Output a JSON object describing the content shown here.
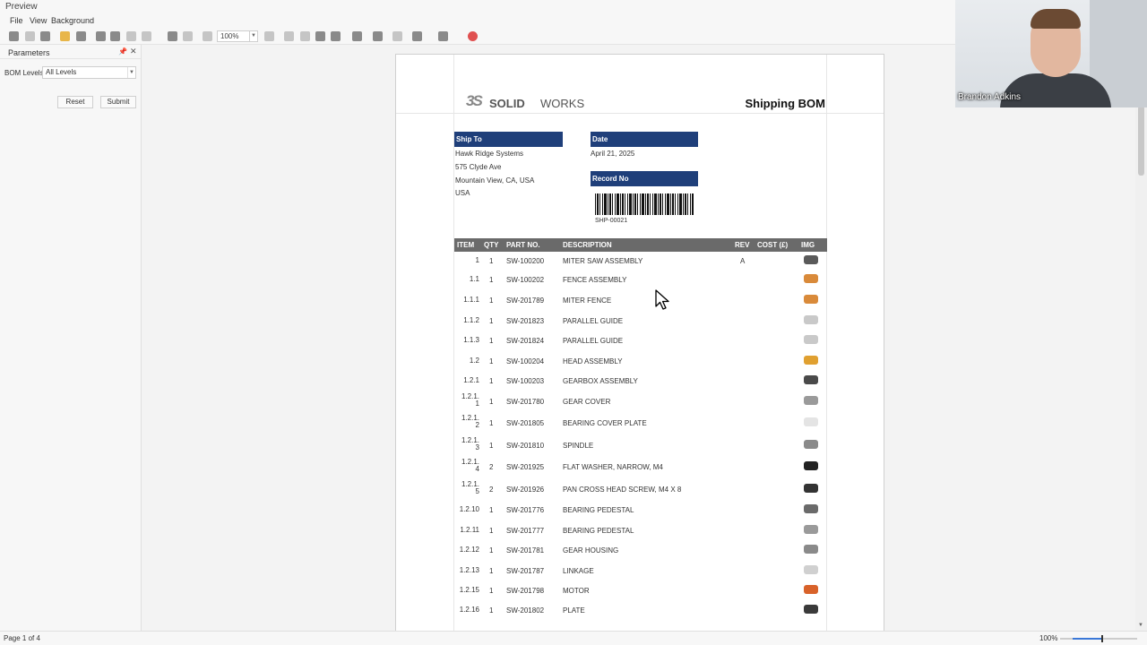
{
  "window": {
    "title": "Preview"
  },
  "menu": {
    "items": [
      "File",
      "View",
      "Background"
    ]
  },
  "toolbar": {
    "zoom_value": "100%"
  },
  "parameters": {
    "title": "Parameters",
    "bom_levels_label": "BOM Levels",
    "bom_levels_value": "All Levels",
    "reset_label": "Reset",
    "submit_label": "Submit"
  },
  "report": {
    "logo_prefix": "SOLID",
    "logo_suffix": "WORKS",
    "logo_mark": "3S",
    "title": "Shipping BOM",
    "ship_to_label": "Ship To",
    "ship_to_lines": [
      "Hawk Ridge Systems",
      "575 Clyde Ave",
      "Mountain View, CA, USA",
      "USA"
    ],
    "date_label": "Date",
    "date_value": "April 21, 2025",
    "record_label": "Record No",
    "record_value": "SHP-00021",
    "columns": [
      "ITEM",
      "QTY",
      "PART NO.",
      "DESCRIPTION",
      "REV",
      "COST (£)",
      "IMG"
    ],
    "rows": [
      {
        "item": "1",
        "qty": "1",
        "part": "SW-100200",
        "desc": "MITER SAW ASSEMBLY",
        "rev": "A",
        "img_color": "#5a5a5a"
      },
      {
        "item": "1.1",
        "qty": "1",
        "part": "SW-100202",
        "desc": "FENCE ASSEMBLY",
        "rev": "",
        "img_color": "#d98a3a"
      },
      {
        "item": "1.1.1",
        "qty": "1",
        "part": "SW-201789",
        "desc": "MITER FENCE",
        "rev": "",
        "img_color": "#d98a3a"
      },
      {
        "item": "1.1.2",
        "qty": "1",
        "part": "SW-201823",
        "desc": "PARALLEL GUIDE",
        "rev": "",
        "img_color": "#c9c9c9"
      },
      {
        "item": "1.1.3",
        "qty": "1",
        "part": "SW-201824",
        "desc": "PARALLEL GUIDE",
        "rev": "",
        "img_color": "#c9c9c9"
      },
      {
        "item": "1.2",
        "qty": "1",
        "part": "SW-100204",
        "desc": "HEAD ASSEMBLY",
        "rev": "",
        "img_color": "#e0a030"
      },
      {
        "item": "1.2.1",
        "qty": "1",
        "part": "SW-100203",
        "desc": "GEARBOX ASSEMBLY",
        "rev": "",
        "img_color": "#4a4a4a"
      },
      {
        "item": "1.2.1.\n1",
        "qty": "1",
        "part": "SW-201780",
        "desc": "GEAR COVER",
        "rev": "",
        "img_color": "#9a9a9a"
      },
      {
        "item": "1.2.1.\n2",
        "qty": "1",
        "part": "SW-201805",
        "desc": "BEARING COVER PLATE",
        "rev": "",
        "img_color": "#e4e4e4"
      },
      {
        "item": "1.2.1.\n3",
        "qty": "1",
        "part": "SW-201810",
        "desc": "SPINDLE",
        "rev": "",
        "img_color": "#8a8a8a"
      },
      {
        "item": "1.2.1.\n4",
        "qty": "2",
        "part": "SW-201925",
        "desc": "FLAT WASHER, NARROW, M4",
        "rev": "",
        "img_color": "#222222"
      },
      {
        "item": "1.2.1.\n5",
        "qty": "2",
        "part": "SW-201926",
        "desc": "PAN CROSS HEAD SCREW, M4 X 8",
        "rev": "",
        "img_color": "#333333"
      },
      {
        "item": "1.2.10",
        "qty": "1",
        "part": "SW-201776",
        "desc": "BEARING PEDESTAL",
        "rev": "",
        "img_color": "#6a6a6a"
      },
      {
        "item": "1.2.11",
        "qty": "1",
        "part": "SW-201777",
        "desc": "BEARING PEDESTAL",
        "rev": "",
        "img_color": "#9a9a9a"
      },
      {
        "item": "1.2.12",
        "qty": "1",
        "part": "SW-201781",
        "desc": "GEAR HOUSING",
        "rev": "",
        "img_color": "#8a8a8a"
      },
      {
        "item": "1.2.13",
        "qty": "1",
        "part": "SW-201787",
        "desc": "LINKAGE",
        "rev": "",
        "img_color": "#d0d0d0"
      },
      {
        "item": "1.2.15",
        "qty": "1",
        "part": "SW-201798",
        "desc": "MOTOR",
        "rev": "",
        "img_color": "#d8622a"
      },
      {
        "item": "1.2.16",
        "qty": "1",
        "part": "SW-201802",
        "desc": "PLATE",
        "rev": "",
        "img_color": "#3a3a3a"
      }
    ]
  },
  "status": {
    "page": "Page 1 of 4",
    "zoom": "100%",
    "zoom_fraction": 0.55
  },
  "webcam": {
    "name": "Brandon Adkins"
  }
}
